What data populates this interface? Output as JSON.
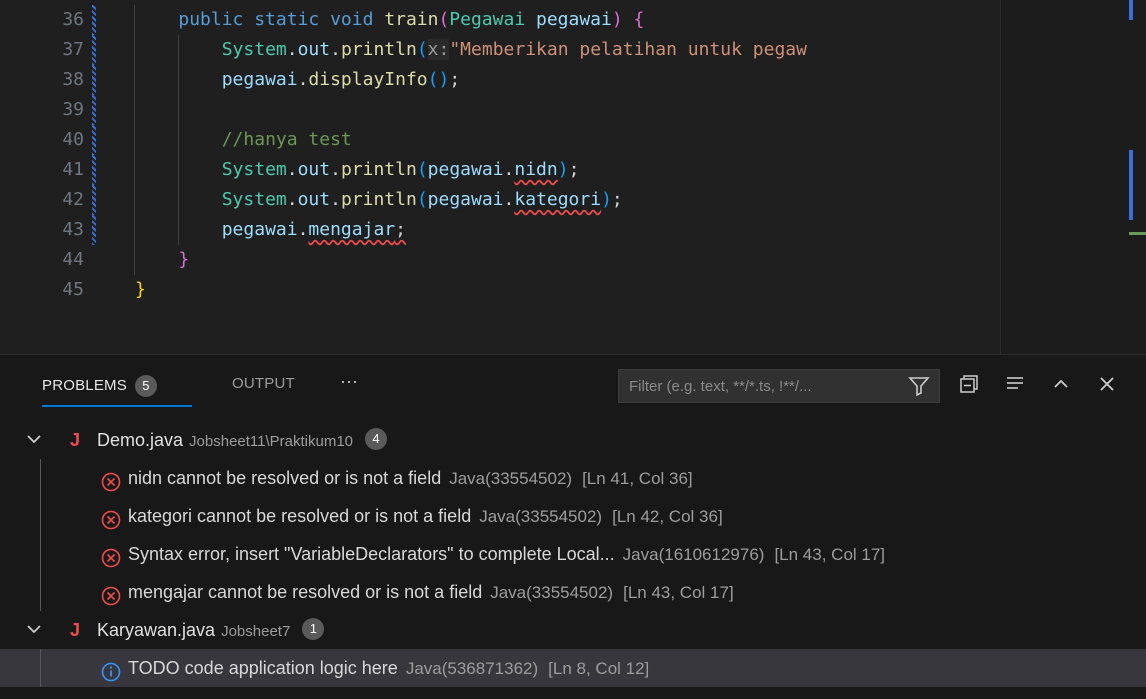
{
  "editor": {
    "lines": [
      {
        "number": "36",
        "tokens": [
          {
            "t": "public ",
            "c": "kw"
          },
          {
            "t": "static ",
            "c": "kw"
          },
          {
            "t": "void ",
            "c": "kw"
          },
          {
            "t": "train",
            "c": "fn"
          },
          {
            "t": "(",
            "c": "b2"
          },
          {
            "t": "Pegawai ",
            "c": "type"
          },
          {
            "t": "pegawai",
            "c": "var"
          },
          {
            "t": ") ",
            "c": "b2"
          },
          {
            "t": "{",
            "c": "b2"
          }
        ],
        "indent": 2
      },
      {
        "number": "37",
        "tokens": [
          {
            "t": "System",
            "c": "type"
          },
          {
            "t": ".",
            "c": "pl"
          },
          {
            "t": "out",
            "c": "var"
          },
          {
            "t": ".",
            "c": "pl"
          },
          {
            "t": "println",
            "c": "fn"
          },
          {
            "t": "(",
            "c": "b3"
          },
          {
            "t": "x:",
            "c": "hint"
          },
          {
            "t": "\"Memberikan pelatihan untuk pegaw",
            "c": "str"
          }
        ],
        "indent": 3
      },
      {
        "number": "38",
        "tokens": [
          {
            "t": "pegawai",
            "c": "var"
          },
          {
            "t": ".",
            "c": "pl"
          },
          {
            "t": "displayInfo",
            "c": "fn"
          },
          {
            "t": "()",
            "c": "b3"
          },
          {
            "t": ";",
            "c": "pl"
          }
        ],
        "indent": 3
      },
      {
        "number": "39",
        "tokens": [],
        "indent": 3
      },
      {
        "number": "40",
        "tokens": [
          {
            "t": "//hanya test",
            "c": "cmt"
          }
        ],
        "indent": 3
      },
      {
        "number": "41",
        "tokens": [
          {
            "t": "System",
            "c": "type"
          },
          {
            "t": ".",
            "c": "pl"
          },
          {
            "t": "out",
            "c": "var"
          },
          {
            "t": ".",
            "c": "pl"
          },
          {
            "t": "println",
            "c": "fn"
          },
          {
            "t": "(",
            "c": "b3"
          },
          {
            "t": "pegawai",
            "c": "var"
          },
          {
            "t": ".",
            "c": "pl"
          },
          {
            "t": "nidn",
            "c": "var squig"
          },
          {
            "t": ")",
            "c": "b3"
          },
          {
            "t": ";",
            "c": "pl"
          }
        ],
        "indent": 3
      },
      {
        "number": "42",
        "tokens": [
          {
            "t": "System",
            "c": "type"
          },
          {
            "t": ".",
            "c": "pl"
          },
          {
            "t": "out",
            "c": "var"
          },
          {
            "t": ".",
            "c": "pl"
          },
          {
            "t": "println",
            "c": "fn"
          },
          {
            "t": "(",
            "c": "b3"
          },
          {
            "t": "pegawai",
            "c": "var"
          },
          {
            "t": ".",
            "c": "pl"
          },
          {
            "t": "kategori",
            "c": "var squig"
          },
          {
            "t": ")",
            "c": "b3"
          },
          {
            "t": ";",
            "c": "pl"
          }
        ],
        "indent": 3
      },
      {
        "number": "43",
        "tokens": [
          {
            "t": "pegawai",
            "c": "var"
          },
          {
            "t": ".",
            "c": "pl"
          },
          {
            "t": "mengajar",
            "c": "var squig"
          },
          {
            "t": ";",
            "c": "pl squig"
          }
        ],
        "indent": 3
      },
      {
        "number": "44",
        "tokens": [
          {
            "t": "}",
            "c": "b2"
          }
        ],
        "indent": 2
      },
      {
        "number": "45",
        "tokens": [
          {
            "t": "}",
            "c": "b1"
          }
        ],
        "indent": 1
      }
    ]
  },
  "panel": {
    "tab_problems": "PROBLEMS",
    "problems_count": "5",
    "tab_output": "OUTPUT",
    "more": "···",
    "filter_placeholder": "Filter (e.g. text, **/*.ts, !**/...",
    "groups": [
      {
        "file": "Demo.java",
        "path": "Jobsheet11\\Praktikum10",
        "count": "4",
        "items": [
          {
            "severity": "error",
            "message": "nidn cannot be resolved or is not a field",
            "source": "Java(33554502)",
            "position": "[Ln 41, Col 36]"
          },
          {
            "severity": "error",
            "message": "kategori cannot be resolved or is not a field",
            "source": "Java(33554502)",
            "position": "[Ln 42, Col 36]"
          },
          {
            "severity": "error",
            "message": "Syntax error, insert \"VariableDeclarators\" to complete Local...",
            "source": "Java(1610612976)",
            "position": "[Ln 43, Col 17]"
          },
          {
            "severity": "error",
            "message": "mengajar cannot be resolved or is not a field",
            "source": "Java(33554502)",
            "position": "[Ln 43, Col 17]"
          }
        ]
      },
      {
        "file": "Karyawan.java",
        "path": "Jobsheet7",
        "count": "1",
        "items": [
          {
            "severity": "info",
            "message": "TODO code application logic here",
            "source": "Java(536871362)",
            "position": "[Ln 8, Col 12]"
          }
        ]
      }
    ]
  },
  "icons": {
    "file_icon": "J",
    "error_icon": "error-circle-icon",
    "info_icon": "info-circle-icon"
  },
  "colors": {
    "error": "#f14c4c",
    "info": "#3794ff",
    "accent": "#0078d4"
  }
}
